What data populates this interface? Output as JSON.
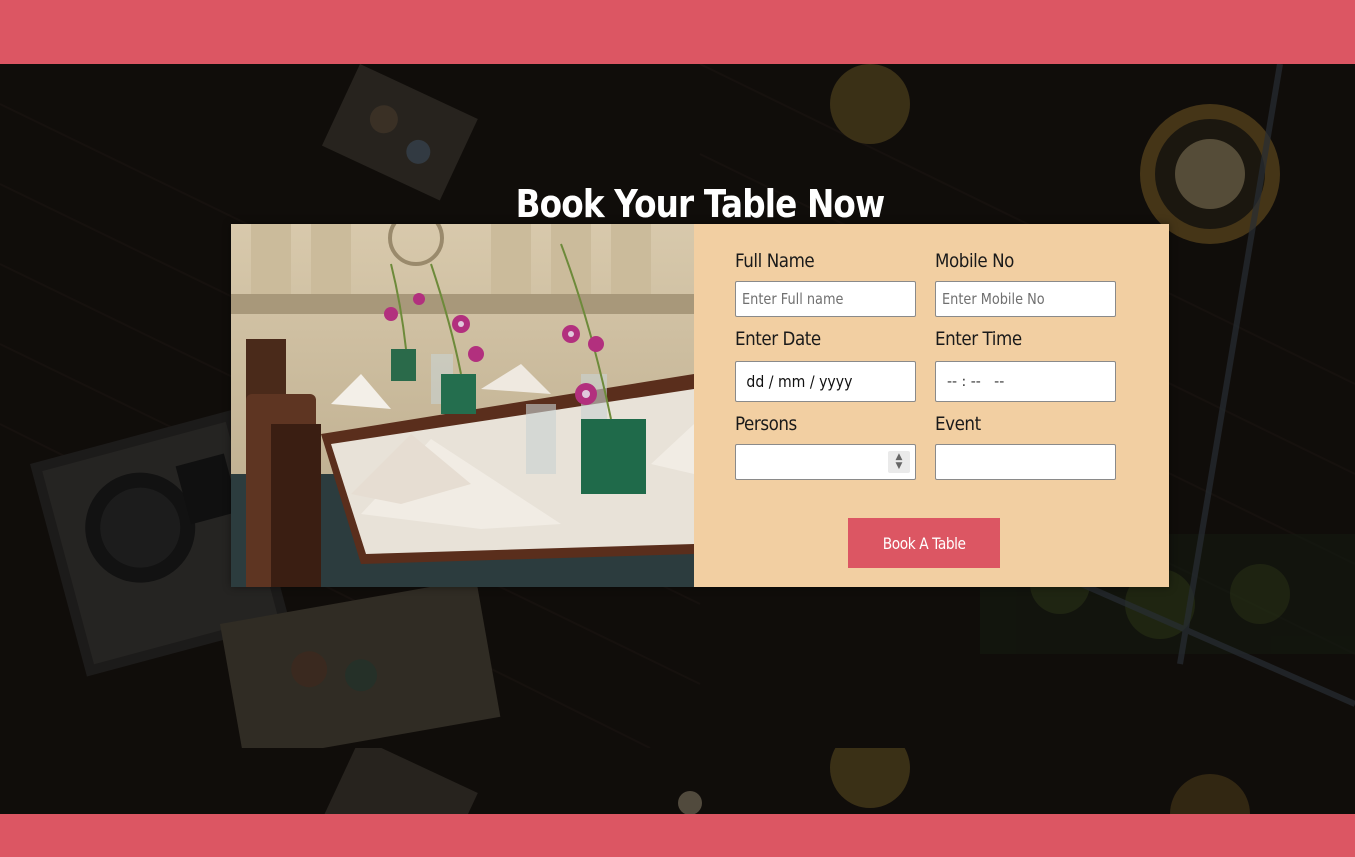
{
  "page": {
    "title": "Book Your Table Now"
  },
  "colors": {
    "accent": "#dc5663",
    "form_background": "#f2cfa2",
    "overlay": "#15110e"
  },
  "form": {
    "full_name": {
      "label": "Full Name",
      "placeholder": "Enter Full name"
    },
    "mobile": {
      "label": "Mobile No",
      "placeholder": "Enter Mobile No"
    },
    "date": {
      "label": "Enter Date",
      "value": "dd / mm / yyyy"
    },
    "time": {
      "label": "Enter Time",
      "value": "-- : --   --"
    },
    "persons": {
      "label": "Persons",
      "value": ""
    },
    "event": {
      "label": "Event",
      "value": ""
    },
    "submit_label": "Book A Table"
  },
  "images": {
    "hero_background": "restaurant-overhead-photo",
    "card_photo": "set-dining-table-photo"
  },
  "icons": {
    "spinner_up": "chevron-up-icon",
    "spinner_down": "chevron-down-icon"
  }
}
